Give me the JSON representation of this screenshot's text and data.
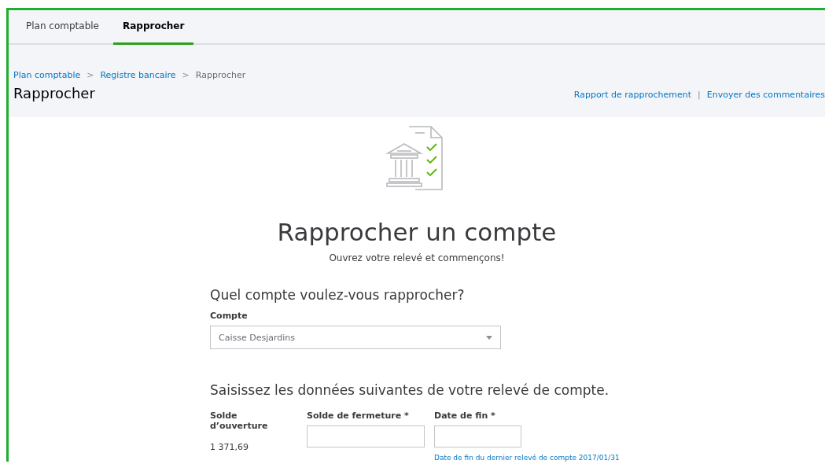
{
  "tabs": [
    {
      "label": "Plan comptable",
      "selected": false
    },
    {
      "label": "Rapprocher",
      "selected": true
    }
  ],
  "breadcrumb": [
    "Plan comptable",
    "Registre bancaire",
    "Rapprocher"
  ],
  "breadcrumb_separator": ">",
  "page_title": "Rapprocher",
  "header_links": [
    "Rapport de rapprochement",
    "Envoyer des commentaires"
  ],
  "header_link_separator": "|",
  "hero": {
    "title": "Rapprocher un compte",
    "subtitle": "Ouvrez votre relevé et commençons!"
  },
  "account_section": {
    "heading": "Quel compte voulez-vous rapprocher?",
    "label": "Compte",
    "value": "Caisse Desjardins"
  },
  "statement_section": {
    "heading": "Saisissez les données suivantes de votre relevé de compte.",
    "opening_balance": {
      "label": "Solde d’ouverture",
      "value": "1 371,69"
    },
    "ending_balance": {
      "label": "Solde de fermeture *"
    },
    "ending_date": {
      "label": "Date de fin *",
      "hint": "Date de fin du dernier relevé de compte 2017/01/31"
    }
  }
}
